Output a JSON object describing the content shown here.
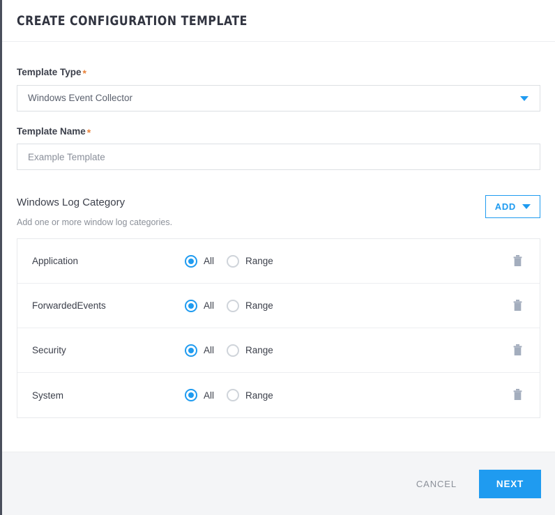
{
  "header": {
    "title": "CREATE CONFIGURATION TEMPLATE"
  },
  "colors": {
    "accent_blue": "#1f9bf0",
    "required_orange": "#e8823a",
    "text_dark": "#3b3f4a",
    "text_muted": "#8b9099",
    "footer_bg": "#f4f5f7",
    "border": "#dcdfe3",
    "trash_icon": "#a3adbd"
  },
  "form": {
    "template_type": {
      "label": "Template Type",
      "required_marker": "*",
      "selected_value": "Windows Event Collector",
      "caret_icon": "chevron-down-icon"
    },
    "template_name": {
      "label": "Template Name",
      "required_marker": "*",
      "value": "",
      "placeholder": "Example Template"
    }
  },
  "log_category_section": {
    "title": "Windows Log Category",
    "subtitle": "Add one or more window log categories.",
    "add_button": {
      "label": "ADD",
      "caret_icon": "chevron-down-icon"
    },
    "radio_options": {
      "all_label": "All",
      "range_label": "Range"
    },
    "delete_icon": "trash-icon",
    "rows": [
      {
        "name": "Application",
        "selected": "All"
      },
      {
        "name": "ForwardedEvents",
        "selected": "All"
      },
      {
        "name": "Security",
        "selected": "All"
      },
      {
        "name": "System",
        "selected": "All"
      }
    ]
  },
  "footer": {
    "cancel_label": "CANCEL",
    "next_label": "NEXT"
  }
}
